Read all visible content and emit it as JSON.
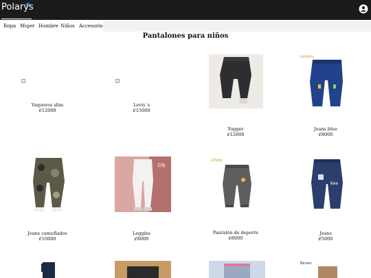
{
  "brand": {
    "logo_text": "Polarys"
  },
  "nav": {
    "items": [
      "Ropa",
      "Mujer",
      "Hombre",
      "Niños",
      "Accesorios"
    ]
  },
  "page": {
    "title": "Pantalones para niños"
  },
  "products": [
    {
      "name": "Vaqueros slim",
      "price": "₡12000"
    },
    {
      "name": "Levis´s",
      "price": "₡15000"
    },
    {
      "name": "Yogger",
      "price": "₡12000"
    },
    {
      "name": "Jeans blue",
      "price": "₡8000"
    },
    {
      "name": "Jeans camuflados",
      "price": "₡10000"
    },
    {
      "name": "Leggins",
      "price": "₡8000"
    },
    {
      "name": "Pantalón de deporte",
      "price": "₡8000"
    },
    {
      "name": "Jeans",
      "price": "₡5000"
    }
  ],
  "image_tags": {
    "jeans_blue": "balbaby",
    "leggins": "白色",
    "deporte": "27kids",
    "jeans": "Kee",
    "bottom": "Bereer"
  },
  "colors": {
    "topbar": "#1b1b1b",
    "accent_star": "#4da6ff",
    "nav_strip": "#f2f2f2"
  }
}
